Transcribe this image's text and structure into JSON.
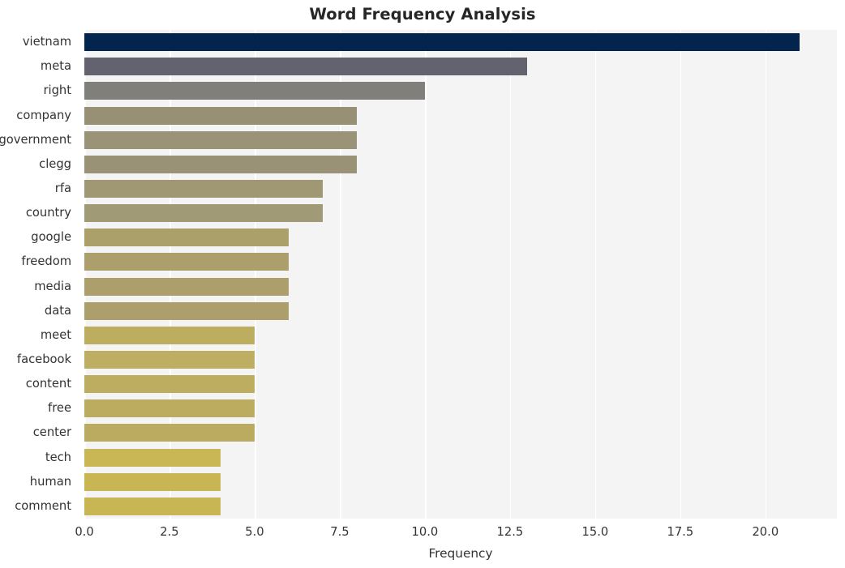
{
  "chart_data": {
    "type": "bar",
    "orientation": "horizontal",
    "title": "Word Frequency Analysis",
    "xlabel": "Frequency",
    "ylabel": "",
    "categories": [
      "vietnam",
      "meta",
      "right",
      "company",
      "government",
      "clegg",
      "rfa",
      "country",
      "google",
      "freedom",
      "media",
      "data",
      "meet",
      "facebook",
      "content",
      "free",
      "center",
      "tech",
      "human",
      "comment"
    ],
    "values": [
      21,
      13,
      10,
      8,
      8,
      8,
      7,
      7,
      6,
      6,
      6,
      6,
      5,
      5,
      5,
      5,
      5,
      4,
      4,
      4
    ],
    "bar_colors": [
      "#03244d",
      "#63636f",
      "#817f7b",
      "#989075",
      "#9a9378",
      "#9a9277",
      "#a09873",
      "#a19a76",
      "#ab9f6a",
      "#ac9f6b",
      "#ac9f6b",
      "#ad9f6b",
      "#bdad5f",
      "#bdae61",
      "#bcad61",
      "#bcac60",
      "#bbab61",
      "#c9b755",
      "#c8b655",
      "#c8b655"
    ],
    "xlim": [
      0,
      22.1
    ],
    "x_ticks": [
      "0.0",
      "2.5",
      "5.0",
      "7.5",
      "10.0",
      "12.5",
      "15.0",
      "17.5",
      "20.0"
    ],
    "x_tick_values": [
      0,
      2.5,
      5,
      7.5,
      10,
      12.5,
      15,
      17.5,
      20
    ],
    "grid": true,
    "grid_axis": "both",
    "grid_color": "#ffffff",
    "plot_background": "#f4f4f5",
    "figure_background": "#ffffff",
    "legend": false,
    "style": "seaborn-whitegrid"
  }
}
